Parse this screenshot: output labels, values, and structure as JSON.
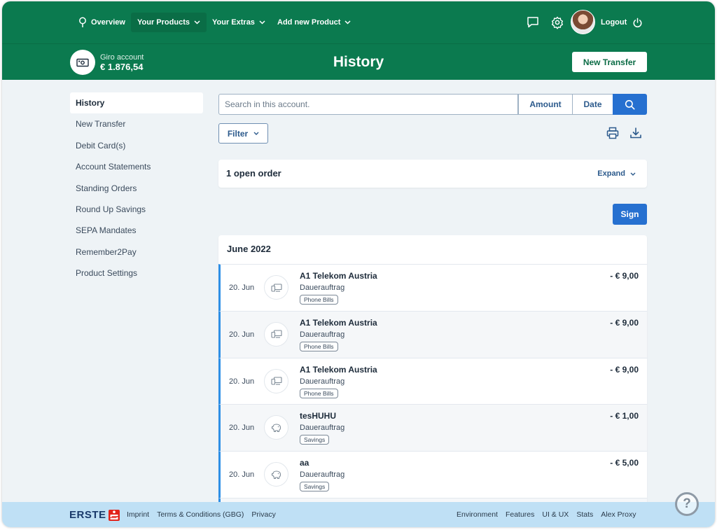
{
  "nav": {
    "overview": "Overview",
    "your_products": "Your Products",
    "your_extras": "Your Extras",
    "add_product": "Add new Product",
    "logout": "Logout"
  },
  "account": {
    "name": "Giro account",
    "balance": "€ 1.876,54"
  },
  "page_title": "History",
  "new_transfer_button": "New Transfer",
  "sidebar": {
    "items": [
      {
        "label": "History"
      },
      {
        "label": "New Transfer"
      },
      {
        "label": "Debit Card(s)"
      },
      {
        "label": "Account Statements"
      },
      {
        "label": "Standing Orders"
      },
      {
        "label": "Round Up Savings"
      },
      {
        "label": "SEPA Mandates"
      },
      {
        "label": "Remember2Pay"
      },
      {
        "label": "Product Settings"
      }
    ]
  },
  "search": {
    "placeholder": "Search in this account.",
    "amount_label": "Amount",
    "date_label": "Date"
  },
  "filter_label": "Filter",
  "open_order": {
    "title": "1 open order",
    "expand_label": "Expand"
  },
  "sign_label": "Sign",
  "month_label": "June 2022",
  "transactions": [
    {
      "date": "20. Jun",
      "name": "A1 Telekom Austria",
      "type": "Dauerauftrag",
      "tag": "Phone Bills",
      "amount": "- € 9,00",
      "icon": "phone-bill-icon"
    },
    {
      "date": "20. Jun",
      "name": "A1 Telekom Austria",
      "type": "Dauerauftrag",
      "tag": "Phone Bills",
      "amount": "- € 9,00",
      "icon": "phone-bill-icon"
    },
    {
      "date": "20. Jun",
      "name": "A1 Telekom Austria",
      "type": "Dauerauftrag",
      "tag": "Phone Bills",
      "amount": "- € 9,00",
      "icon": "phone-bill-icon"
    },
    {
      "date": "20. Jun",
      "name": "tesHUHU",
      "type": "Dauerauftrag",
      "tag": "Savings",
      "amount": "- € 1,00",
      "icon": "piggy-bank-icon"
    },
    {
      "date": "20. Jun",
      "name": "aa",
      "type": "Dauerauftrag",
      "tag": "Savings",
      "amount": "- € 5,00",
      "icon": "piggy-bank-icon"
    }
  ],
  "footer": {
    "logo": "ERSTE",
    "left_links": [
      "Imprint",
      "Terms & Conditions (GBG)",
      "Privacy"
    ],
    "right_links": [
      "Environment",
      "Features",
      "UI & UX",
      "Stats",
      "Alex Proxy"
    ]
  },
  "help_label": "?",
  "colors": {
    "brand_green": "#0b7a4f",
    "primary_blue": "#2670d0",
    "footer_blue": "#bfe0f5"
  }
}
